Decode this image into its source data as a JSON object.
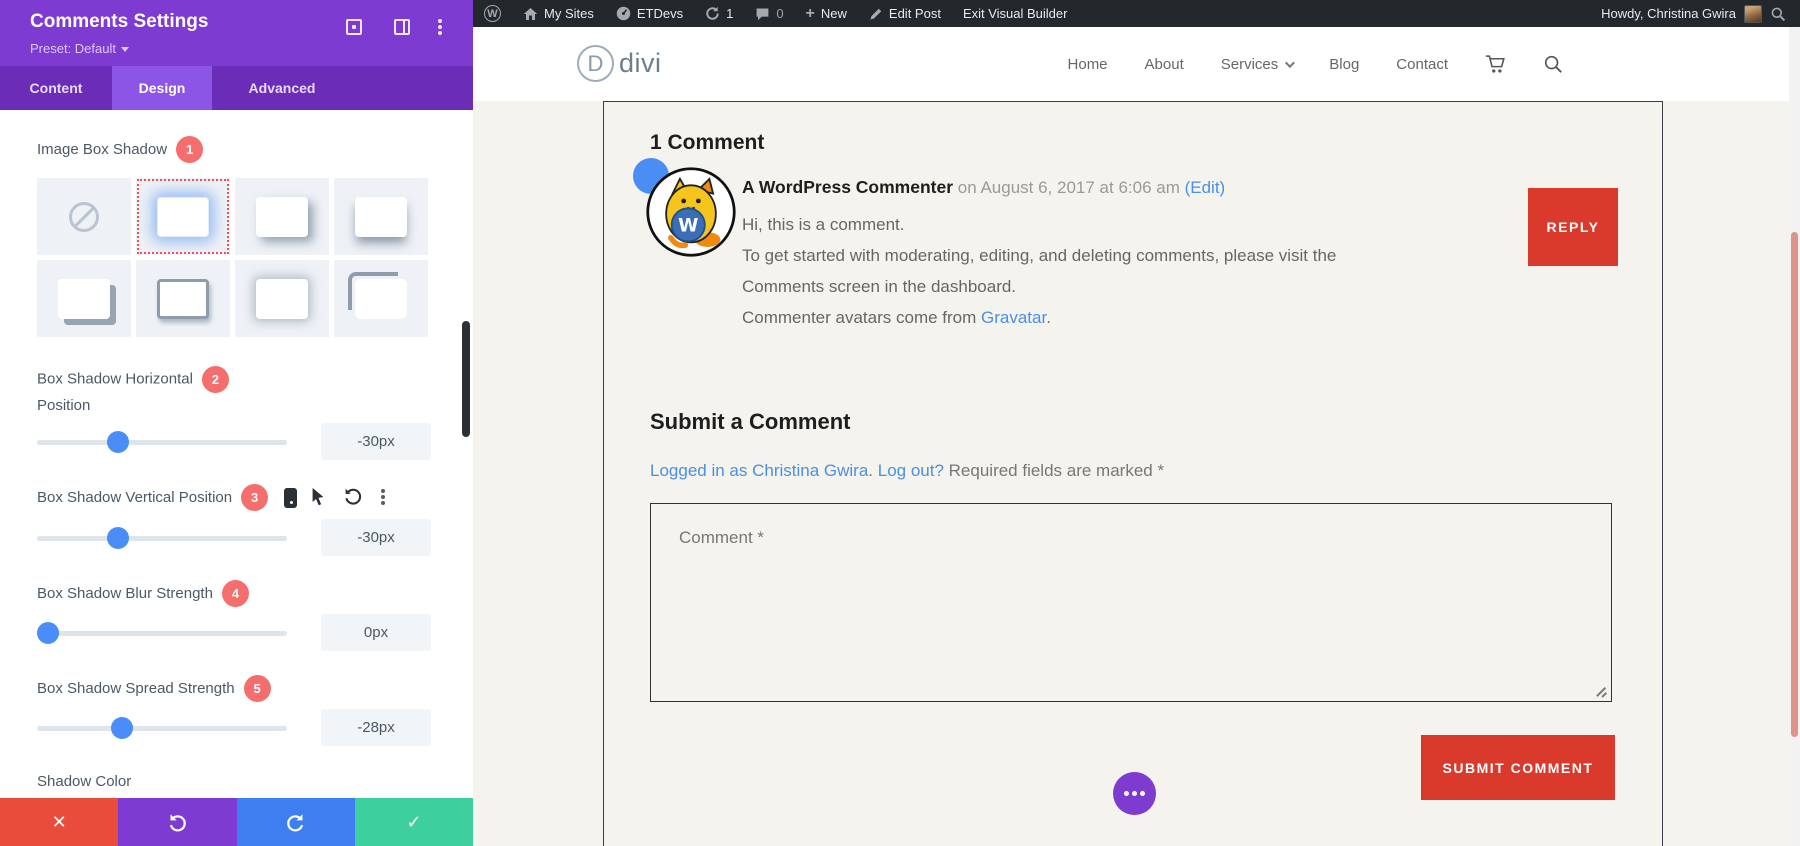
{
  "admin_bar": {
    "wp_logo": "W",
    "my_sites": "My Sites",
    "etdevs": "ETDevs",
    "update_count": "1",
    "comment_count": "0",
    "new_label": "New",
    "edit_post": "Edit Post",
    "exit_builder": "Exit Visual Builder",
    "howdy": "Howdy, Christina Gwira"
  },
  "panel": {
    "title": "Comments Settings",
    "preset": "Preset: Default",
    "tabs": {
      "content": "Content",
      "design": "Design",
      "advanced": "Advanced"
    },
    "image_box_shadow": {
      "label": "Image Box Shadow",
      "badge": "1"
    },
    "slider1": {
      "label_top": "Box Shadow Horizontal",
      "label_bottom": "Position",
      "badge": "2",
      "value": "-30px"
    },
    "slider2": {
      "label": "Box Shadow Vertical Position",
      "badge": "3",
      "value": "-30px"
    },
    "slider3": {
      "label": "Box Shadow Blur Strength",
      "badge": "4",
      "value": "0px"
    },
    "slider4": {
      "label": "Box Shadow Spread Strength",
      "badge": "5",
      "value": "-28px"
    },
    "shadow_color_label": "Shadow Color"
  },
  "site": {
    "logo_letter": "D",
    "logo_text": "divi",
    "nav": {
      "home": "Home",
      "about": "About",
      "services": "Services",
      "blog": "Blog",
      "contact": "Contact"
    }
  },
  "comments": {
    "heading": "1 Comment",
    "author": "A WordPress Commenter",
    "meta": " on August 6, 2017 at 6:06 am ",
    "edit_link": "(Edit)",
    "line1": "Hi, this is a comment.",
    "line2": "To get started with moderating, editing, and deleting comments, please visit the",
    "line3": "Comments screen in the dashboard.",
    "line4_prefix": "Commenter avatars come from ",
    "gravatar_link": "Gravatar",
    "line4_suffix": ".",
    "reply": "REPLY"
  },
  "form": {
    "heading": "Submit a Comment",
    "logged_in": "Logged in as Christina Gwira",
    "separator": ". ",
    "logout": "Log out?",
    "required": " Required fields are marked *",
    "comment_placeholder": "Comment *",
    "submit": "SUBMIT COMMENT"
  },
  "colors": {
    "divi_purple": "#7e3bd2",
    "tab_bar_purple": "#6b2db8",
    "active_tab_purple": "#8d55e6",
    "badge_red": "#f56e6e",
    "slider_blue": "#4a8df8",
    "button_red": "#d93a2b",
    "link_blue": "#4a90e2",
    "footer_red": "#ea4c3b",
    "footer_blue": "#3e7ef0",
    "footer_green": "#3ecf9f",
    "admin_bar_bg": "#23282d",
    "page_beige": "#f4f3ee"
  }
}
